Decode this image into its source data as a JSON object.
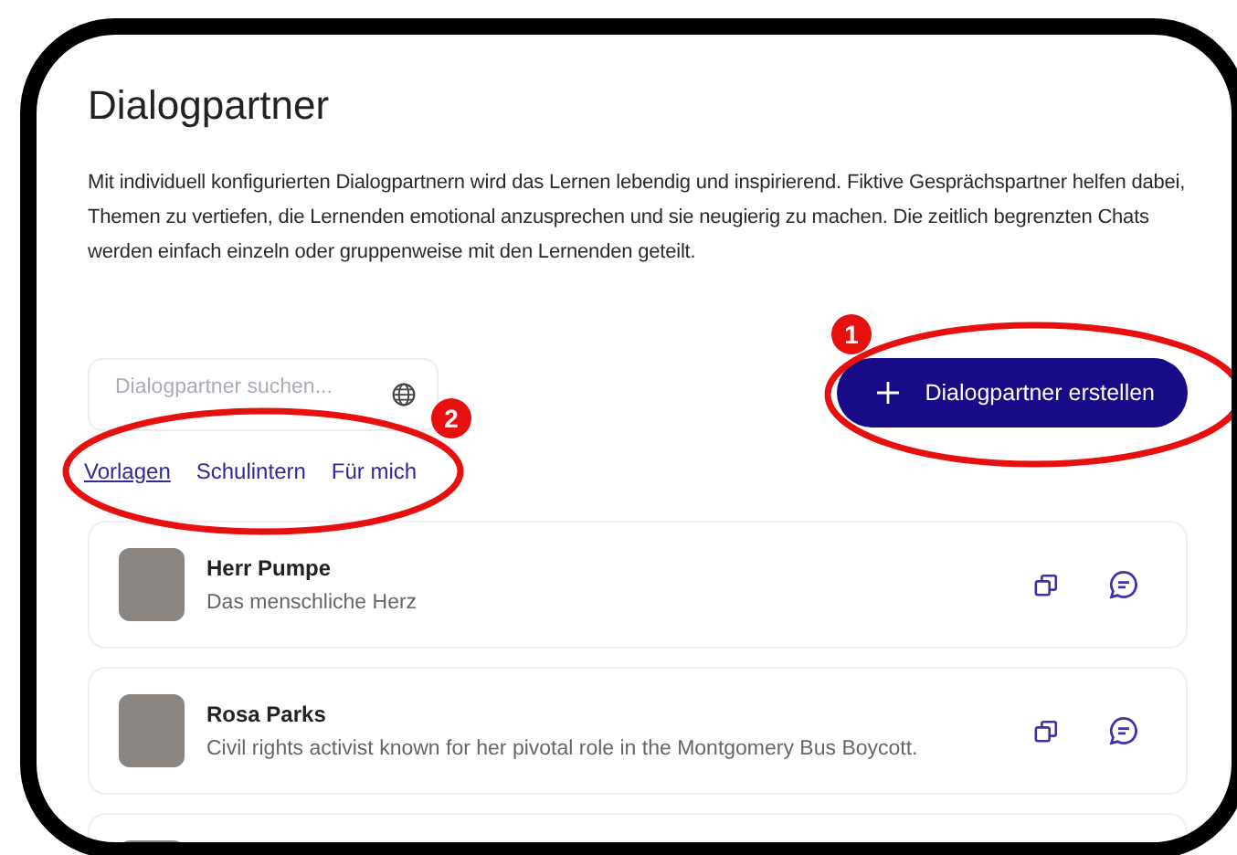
{
  "page": {
    "title": "Dialogpartner",
    "description": "Mit individuell konfigurierten Dialogpartnern wird das Lernen lebendig und inspirierend. Fiktive Gesprächspartner helfen dabei, Themen zu vertiefen, die Lernenden emotional anzusprechen und sie neugierig zu machen. Die zeitlich begrenzten Chats werden einfach einzeln oder gruppenweise mit den Lernenden geteilt."
  },
  "search": {
    "placeholder": "Dialogpartner suchen..."
  },
  "filters": [
    {
      "label": "Vorlagen",
      "selected": true
    },
    {
      "label": "Schulintern",
      "selected": false
    },
    {
      "label": "Für mich",
      "selected": false
    }
  ],
  "create_button": {
    "label": "Dialogpartner erstellen"
  },
  "partners": [
    {
      "name": "Herr Pumpe",
      "description": "Das menschliche Herz"
    },
    {
      "name": "Rosa Parks",
      "description": "Civil rights activist known for her pivotal role in the Montgomery Bus Boycott."
    }
  ],
  "more_below": true,
  "annotations": [
    {
      "number": "1"
    },
    {
      "number": "2"
    }
  ]
}
